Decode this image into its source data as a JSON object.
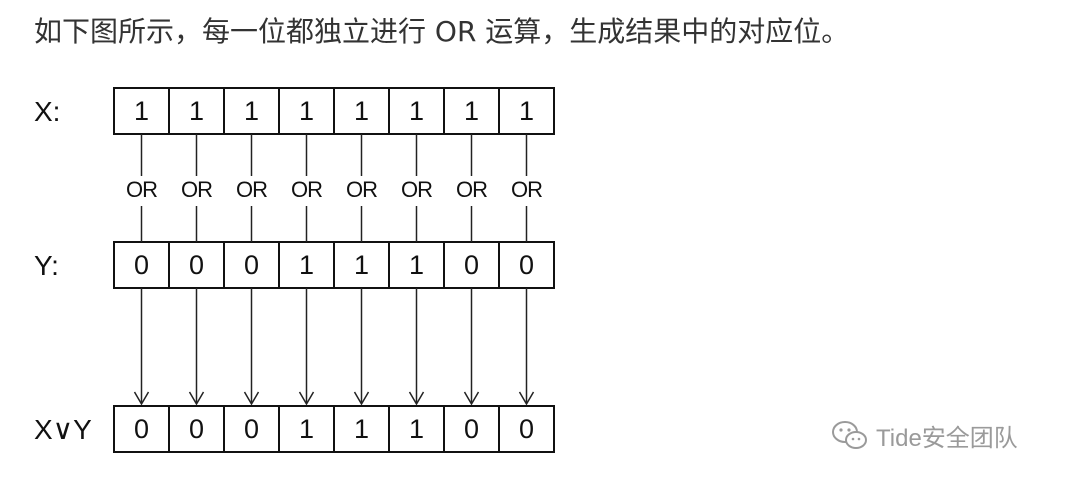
{
  "intro_text": "如下图所示，每一位都独立进行 OR 运算，生成结果中的对应位。",
  "diagram": {
    "operator": "OR",
    "rows": [
      {
        "label": "X:",
        "bits": [
          "1",
          "1",
          "1",
          "1",
          "1",
          "1",
          "1",
          "1"
        ]
      },
      {
        "label": "Y:",
        "bits": [
          "0",
          "0",
          "0",
          "1",
          "1",
          "1",
          "0",
          "0"
        ]
      },
      {
        "label": "X∨Y",
        "bits": [
          "0",
          "0",
          "0",
          "1",
          "1",
          "1",
          "0",
          "0"
        ]
      }
    ]
  },
  "watermark": {
    "text": "Tide安全团队",
    "icon": "wechat-icon"
  }
}
